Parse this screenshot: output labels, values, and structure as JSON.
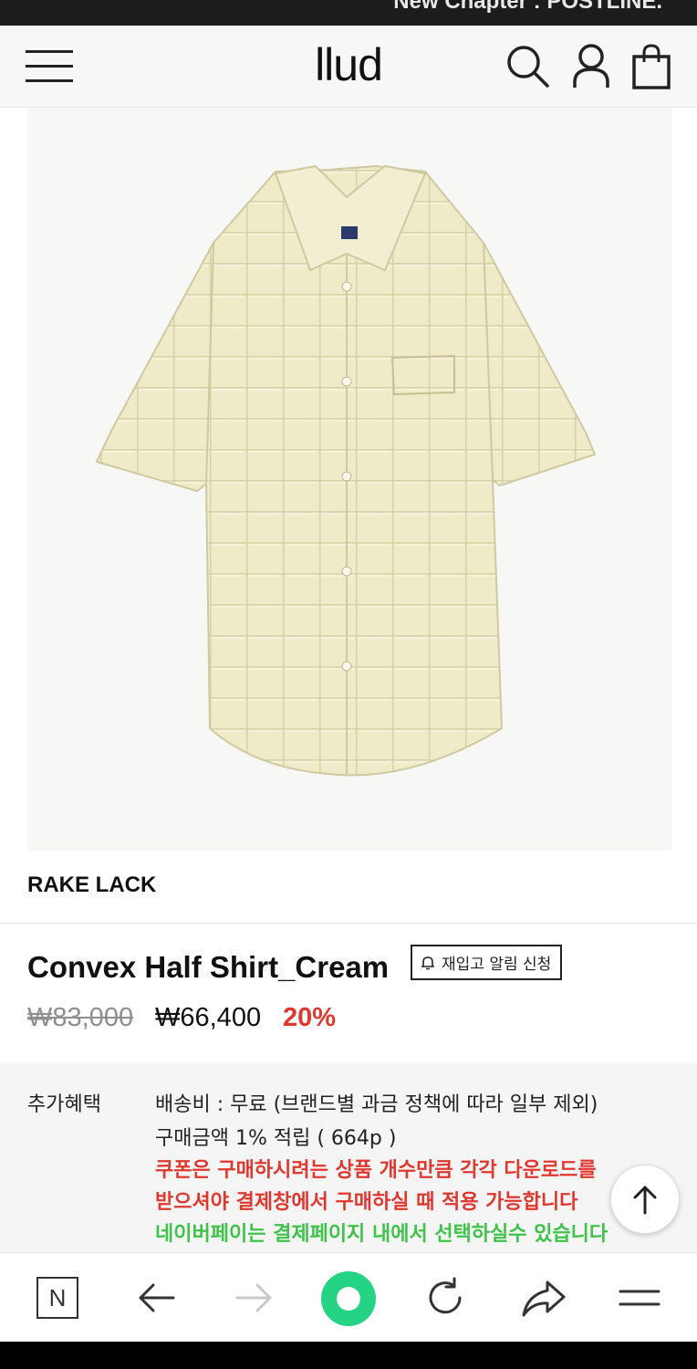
{
  "top_banner": {
    "text": "New Chapter : POSTLINE."
  },
  "header": {
    "logo": "llud",
    "icons": [
      "menu-icon",
      "search-icon",
      "user-icon",
      "shopping-bag-icon"
    ]
  },
  "product": {
    "brand": "RAKE LACK",
    "name": "Convex Half Shirt_Cream",
    "restock_button": "재입고 알림 신청",
    "original_price": "₩83,000",
    "sale_price": "₩66,400",
    "discount": "20%"
  },
  "benefits": {
    "label": "추가혜택",
    "shipping": "배송비 : 무료 (브랜드별 과금 정책에 따라 일부 제외)",
    "points": "구매금액 1% 적립 ( 664p )",
    "coupon_line1": "쿠폰은 구매하시려는 상품 개수만큼 각각 다운로드를",
    "coupon_line2": "받으셔야 결제창에서 구매하실 때 적용 가능합니다",
    "naverpay": "네이버페이는 결제페이지 내에서 선택하실수 있습니다"
  },
  "colors": {
    "accent_red": "#e0372f",
    "accent_green": "#3fc34a",
    "browser_green": "#24d384",
    "shirt": "#efebc9"
  },
  "bottom_toolbar": [
    "naver-n-icon",
    "back-arrow-icon",
    "forward-arrow-icon",
    "green-circle-icon",
    "refresh-icon",
    "share-icon",
    "hamburger-icon"
  ],
  "bottom_toolbar_labels": {
    "n": "N"
  }
}
